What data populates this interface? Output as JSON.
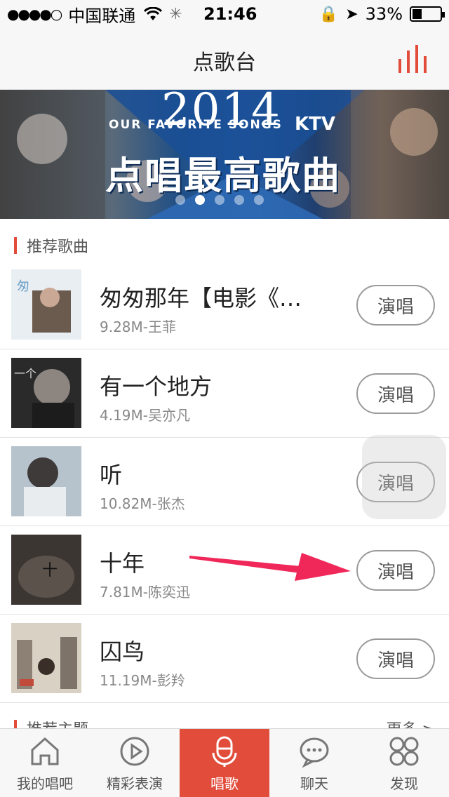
{
  "status_bar": {
    "signal": "●●●●○",
    "carrier": "中国联通",
    "time": "21:46",
    "battery": "33%",
    "battery_level": 0.33
  },
  "nav": {
    "title": "点歌台",
    "icon": "equalizer-icon"
  },
  "banner": {
    "year": "2014",
    "subtitle": "OUR FAVORITE SONGS",
    "ktv": "KTV",
    "headline": "点唱最高歌曲",
    "pages": 5,
    "active_page": 2
  },
  "section": {
    "title": "推荐歌曲"
  },
  "songs": [
    {
      "name": "匆匆那年【电影《…",
      "meta": "9.28M-王菲",
      "action": "演唱"
    },
    {
      "name": "有一个地方",
      "meta": "4.19M-吴亦凡",
      "action": "演唱"
    },
    {
      "name": "听",
      "meta": "10.82M-张杰",
      "action": "演唱"
    },
    {
      "name": "十年",
      "meta": "7.81M-陈奕迅",
      "action": "演唱"
    },
    {
      "name": "囚鸟",
      "meta": "11.19M-彭羚",
      "action": "演唱"
    }
  ],
  "section2": {
    "title": "推荐主题",
    "more": "更多 >"
  },
  "tabs": [
    {
      "label": "我的唱吧",
      "icon": "home-icon"
    },
    {
      "label": "精彩表演",
      "icon": "play-icon"
    },
    {
      "label": "唱歌",
      "icon": "microphone-icon",
      "active": true
    },
    {
      "label": "聊天",
      "icon": "chat-icon"
    },
    {
      "label": "发现",
      "icon": "discover-icon"
    }
  ],
  "colors": {
    "accent": "#e14c3b",
    "arrow": "#f0285a"
  }
}
